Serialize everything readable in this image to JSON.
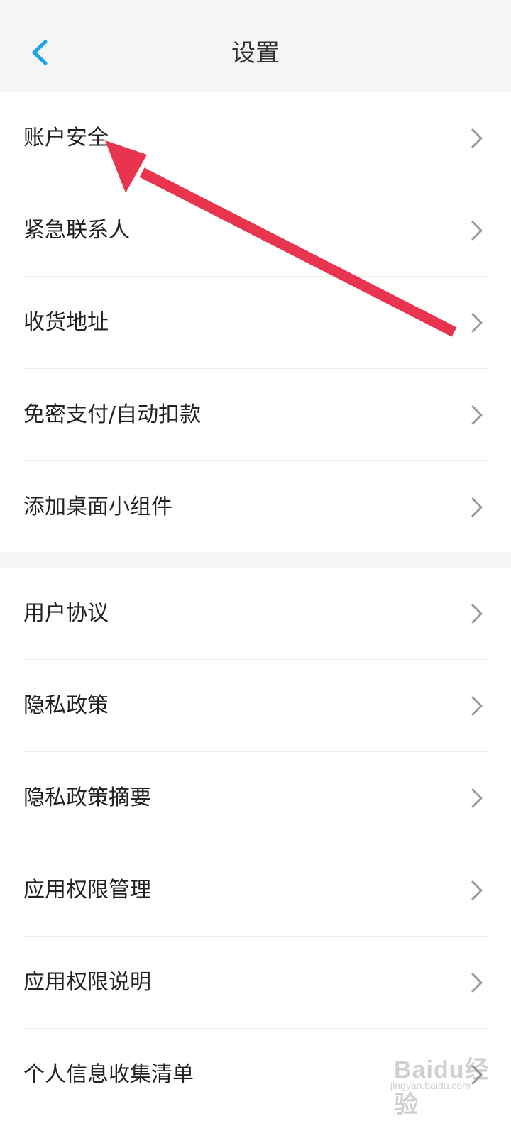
{
  "header": {
    "title": "设置",
    "back_icon": "chevron-left-icon",
    "accent_color": "#1aa3e8"
  },
  "sections": [
    {
      "items": [
        {
          "label": "账户安全"
        },
        {
          "label": "紧急联系人"
        },
        {
          "label": "收货地址"
        },
        {
          "label": "免密支付/自动扣款"
        },
        {
          "label": "添加桌面小组件"
        }
      ]
    },
    {
      "items": [
        {
          "label": "用户协议"
        },
        {
          "label": "隐私政策"
        },
        {
          "label": "隐私政策摘要"
        },
        {
          "label": "应用权限管理"
        },
        {
          "label": "应用权限说明"
        },
        {
          "label": "个人信息收集清单"
        }
      ]
    }
  ],
  "annotation": {
    "arrow_color": "#e8344e"
  },
  "watermark": {
    "brand": "Baidu经验",
    "url": "jingyan.baidu.com"
  }
}
